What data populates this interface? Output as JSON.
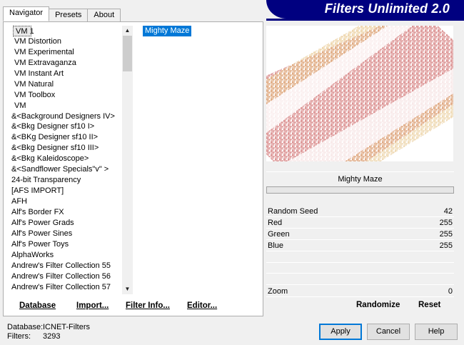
{
  "tabs": [
    {
      "label": "Navigator",
      "active": true
    },
    {
      "label": "Presets",
      "active": false
    },
    {
      "label": "About",
      "active": false
    }
  ],
  "banner": {
    "title": "Filters Unlimited 2.0",
    "color": "#000080"
  },
  "categories": [
    "VM 1",
    "VM Distortion",
    "VM Experimental",
    "VM Extravaganza",
    "VM Instant Art",
    "VM Natural",
    "VM Toolbox",
    "VM",
    "&<Background Designers IV>",
    "&<Bkg Designer sf10 I>",
    "&<BKg Designer sf10 II>",
    "&<Bkg Designer sf10 III>",
    "&<Bkg Kaleidoscope>",
    "&<Sandflower Specials\"v\" >",
    "24-bit Transparency",
    "[AFS IMPORT]",
    "AFH",
    "Alf's Border FX",
    "Alf's Power Grads",
    "Alf's Power Sines",
    "Alf's Power Toys",
    "AlphaWorks",
    "Andrew's Filter Collection 55",
    "Andrew's Filter Collection 56",
    "Andrew's Filter Collection 57"
  ],
  "selected_category": "VM 1",
  "filters": [
    "Mighty Maze"
  ],
  "selected_filter": "Mighty Maze",
  "left_buttons": {
    "database": "Database",
    "import": "Import...",
    "filter_info": "Filter Info...",
    "editor": "Editor..."
  },
  "preview": {
    "filter_name": "Mighty Maze"
  },
  "params": {
    "random_seed": {
      "label": "Random Seed",
      "value": "42"
    },
    "red": {
      "label": "Red",
      "value": "255"
    },
    "green": {
      "label": "Green",
      "value": "255"
    },
    "blue": {
      "label": "Blue",
      "value": "255"
    },
    "zoom": {
      "label": "Zoom",
      "value": "0"
    }
  },
  "right_buttons": {
    "randomize": "Randomize",
    "reset": "Reset"
  },
  "status": {
    "database_label": "Database:",
    "database_value": "ICNET-Filters",
    "filters_label": "Filters:",
    "filters_value": "3293"
  },
  "dialog": {
    "apply": "Apply",
    "cancel": "Cancel",
    "help": "Help"
  },
  "colors": {
    "selection": "#0078d7",
    "maze_red": "#c04040",
    "maze_gold": "#d9a44a"
  }
}
